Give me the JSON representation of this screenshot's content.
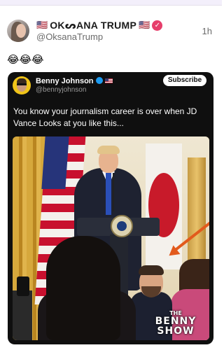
{
  "post": {
    "display_name": "OKᔕANA TRUMP",
    "flag_left": "🇺🇸",
    "flag_right": "🇺🇸",
    "handle": "@OksanaTrump",
    "time": "1h",
    "text": "😂😂😂",
    "verified_color": "#e63e6b"
  },
  "embedded": {
    "author_name": "Benny Johnson",
    "author_handle": "@bennyjohnson",
    "subscribe_label": "Subscribe",
    "text": "You know your journalism career is over when JD Vance Looks at you like this...",
    "watermark_line1": "THE",
    "watermark_line2": "BENNY",
    "watermark_line3": "SHOW",
    "verified_color": "#1d9bf0",
    "arrow_color": "#e25a1c"
  }
}
